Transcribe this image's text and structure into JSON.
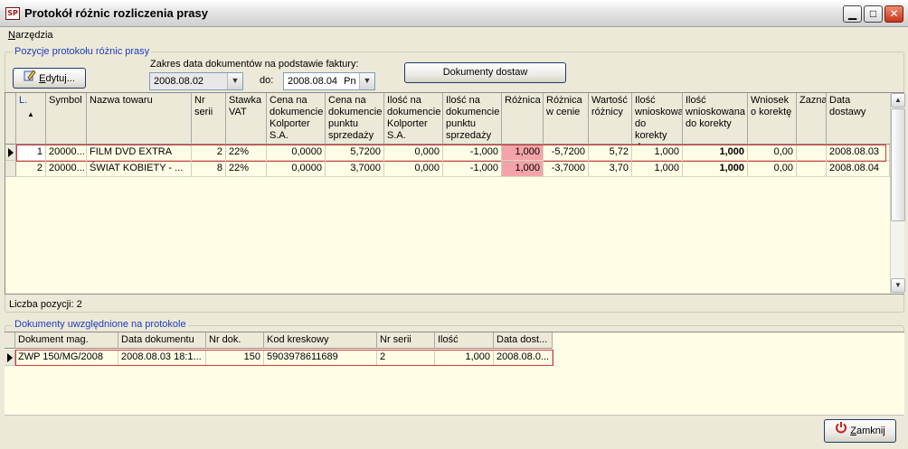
{
  "window": {
    "title": "Protokół różnic rozliczenia prasy",
    "app_icon_text": "SP",
    "minimize_glyph": "▁",
    "maximize_glyph": "□",
    "close_glyph": "✕"
  },
  "menu": {
    "first_letter": "N",
    "rest": "arzędzia"
  },
  "positions_group": {
    "title": "Pozycje protokołu różnic prasy",
    "edit_button": {
      "icon": "pencil-icon",
      "label_u": "E",
      "label_rest": "dytuj..."
    },
    "date_range_label": "Zakres data dokumentów na podstawie faktury:",
    "date_from": "2008.08.02",
    "to_label": "do:",
    "date_to": "2008.08.04",
    "date_to_day": "Pn",
    "delivery_docs_button": "Dokumenty dostaw",
    "columns": [
      "L.",
      "Symbol",
      "Nazwa towaru",
      "Nr serii",
      "Stawka VAT",
      "Cena na dokumencie Kolporter S.A.",
      "Cena na dokumencie punktu sprzedaży",
      "Ilość na dokumencie Kolporter S.A.",
      "Ilość na dokumencie punktu sprzedaży",
      "Różnica",
      "Różnica w cenie",
      "Wartość różnicy",
      "Ilość wnioskowana do korekty dysp.",
      "Ilość wnioskowana do korekty",
      "Wniosek o korektę",
      "Zaznaczone",
      "Data dostawy"
    ],
    "sort_glyph": "▲",
    "rows": [
      [
        "1",
        "20000...",
        "FILM DVD EXTRA",
        "2",
        "22%",
        "0,0000",
        "5,7200",
        "0,000",
        "-1,000",
        "1,000",
        "-5,7200",
        "5,72",
        "1,000",
        "1,000",
        "0,00",
        "",
        "2008.08.03"
      ],
      [
        "2",
        "20000...",
        "ŚWIAT KOBIETY - ...",
        "8",
        "22%",
        "0,0000",
        "3,7000",
        "0,000",
        "-1,000",
        "1,000",
        "-3,7000",
        "3,70",
        "1,000",
        "1,000",
        "0,00",
        "",
        "2008.08.04"
      ]
    ],
    "count_label": "Liczba pozycji: 2"
  },
  "docs_group": {
    "title": "Dokumenty uwzględnione na protokole",
    "columns": [
      "Dokument mag.",
      "Data dokumentu",
      "Nr dok.",
      "Kod kreskowy",
      "Nr serii",
      "Ilość",
      "Data dost..."
    ],
    "rows": [
      [
        "ZWP 150/MG/2008",
        "2008.08.03 18:1...",
        "150",
        "5903978611689",
        "2",
        "1,000",
        "2008.08.0..."
      ]
    ]
  },
  "close_button": {
    "icon": "power-icon",
    "label_u": "Z",
    "label_rest": "amknij"
  },
  "colors": {
    "difference_highlight": "#f4a3a8",
    "selection_outline": "#d23a3a",
    "group_title": "#1c3cc0"
  }
}
